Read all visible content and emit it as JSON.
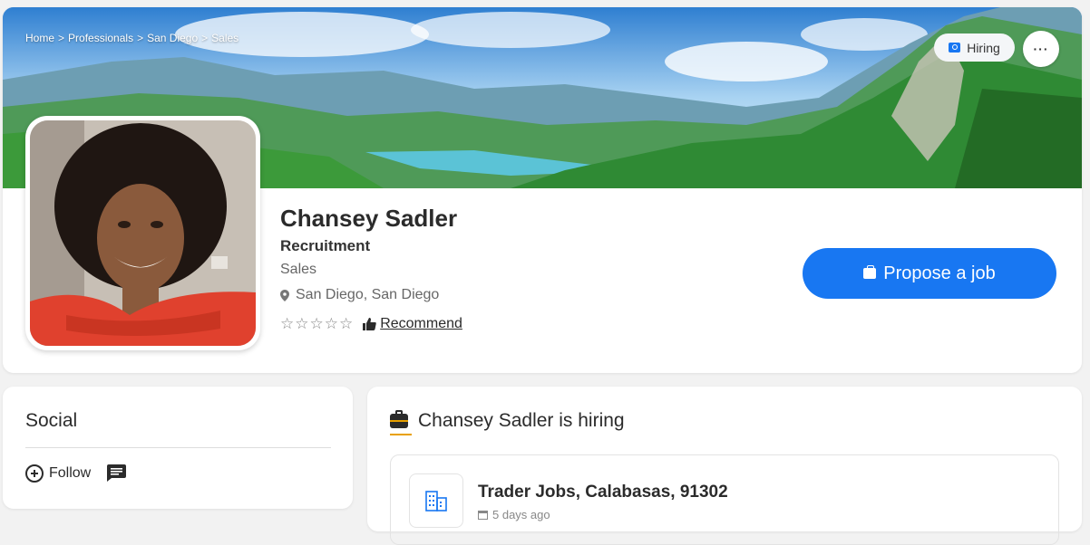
{
  "breadcrumb": [
    "Home",
    "Professionals",
    "San Diego",
    "Sales"
  ],
  "header": {
    "hiring_label": "Hiring",
    "more_label": "···"
  },
  "profile": {
    "name": "Chansey Sadler",
    "role": "Recruitment",
    "department": "Sales",
    "location": "San Diego, San Diego",
    "stars": "☆☆☆☆☆",
    "rating": 0,
    "recommend_label": "Recommend",
    "propose_label": "Propose a job"
  },
  "social": {
    "title": "Social",
    "follow_label": "Follow"
  },
  "hiring": {
    "heading": "Chansey Sadler is hiring",
    "job_title": "Trader Jobs, Calabasas, 91302",
    "posted": "5 days ago"
  },
  "colors": {
    "accent": "#1877f2",
    "highlight": "#e8a000"
  }
}
